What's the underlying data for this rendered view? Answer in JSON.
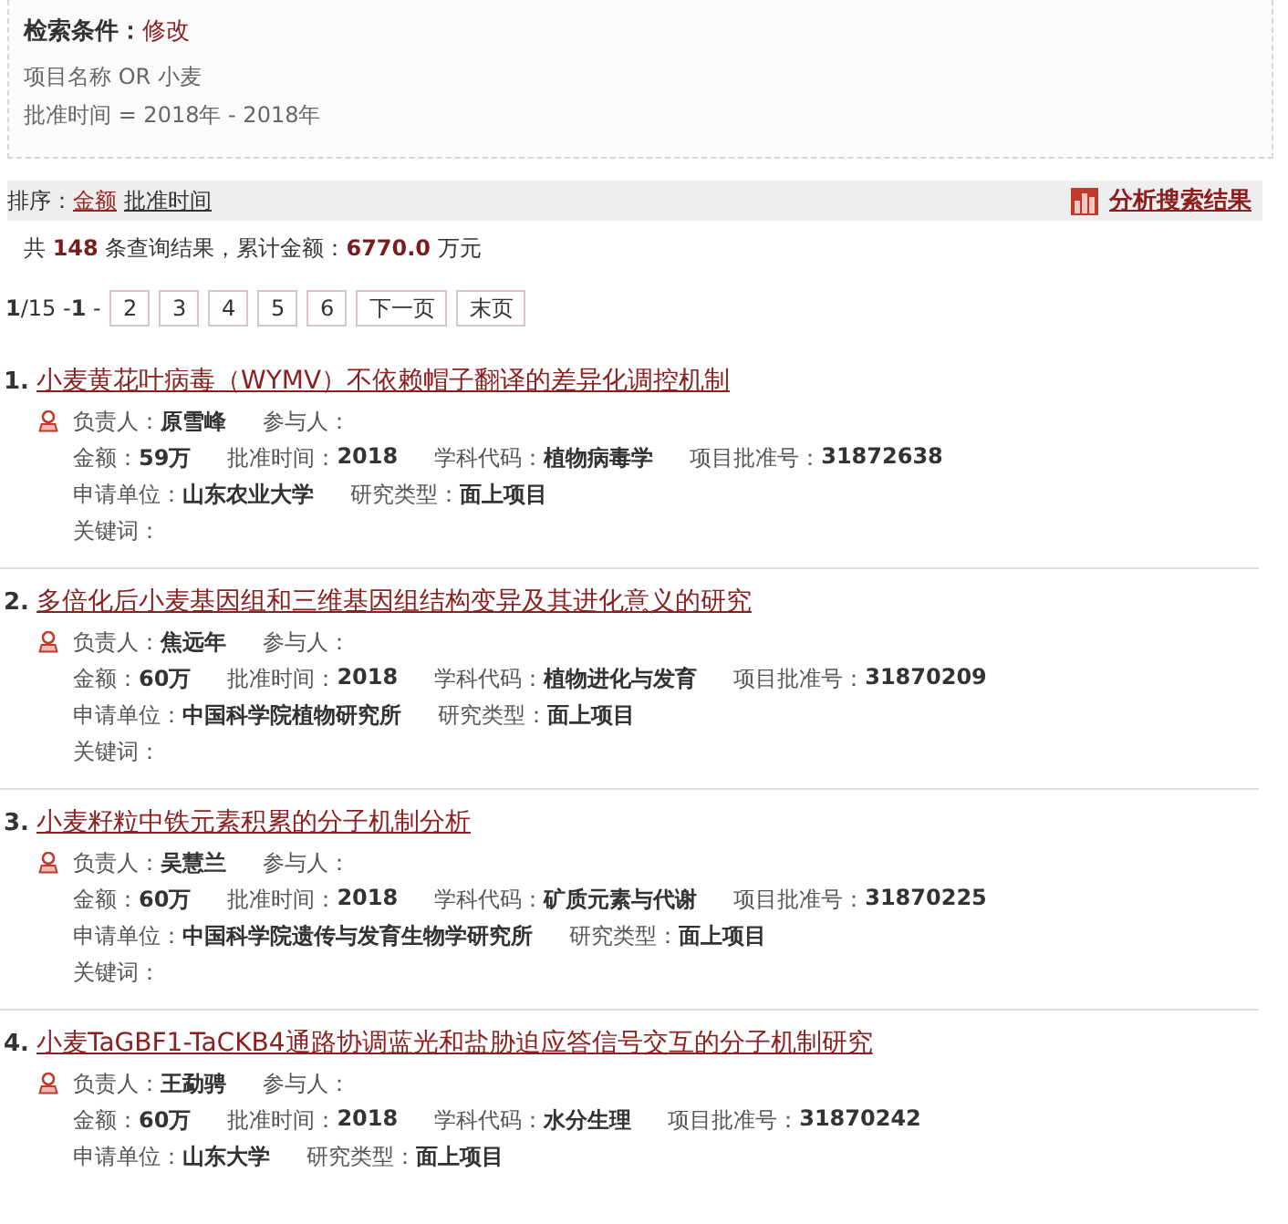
{
  "criteria": {
    "label": "检索条件：",
    "edit_link": "修改",
    "lines": [
      "项目名称 OR 小麦",
      "批准时间 = 2018年 - 2018年"
    ]
  },
  "sort": {
    "label": "排序：",
    "options": [
      {
        "label": "金额",
        "selected": true
      },
      {
        "label": "批准时间",
        "selected": false
      }
    ],
    "analyze_link": "分析搜索结果"
  },
  "summary": "共 **148** 条查询结果，累计金额：**6770.0** 万元",
  "pagination": {
    "status": "**1**/15 -**1** -",
    "pages": [
      "2",
      "3",
      "4",
      "5",
      "6",
      "下一页",
      "末页"
    ]
  },
  "results": [
    {
      "number": "1.",
      "title": "小麦黄花叶病毒（WYMV）不依赖帽子翻译的差异化调控机制",
      "leader": {
        "label": "负责人：",
        "value": "原雪峰"
      },
      "participants": {
        "label": "参与人："
      },
      "amount": {
        "label": "金额：",
        "value": "59万"
      },
      "approval_time": {
        "label": "批准时间：",
        "value": "2018"
      },
      "discipline_code": {
        "label": "学科代码：",
        "value": "植物病毒学"
      },
      "approval_number": {
        "label": "项目批准号：",
        "value": "31872638"
      },
      "applicant_unit": {
        "label": "申请单位：",
        "value": "山东农业大学"
      },
      "research_type": {
        "label": "研究类型：",
        "value": "面上项目"
      },
      "keywords": {
        "label": "关键词："
      }
    },
    {
      "number": "2.",
      "title": "多倍化后小麦基因组和三维基因组结构变异及其进化意义的研究",
      "leader": {
        "label": "负责人：",
        "value": "焦远年"
      },
      "participants": {
        "label": "参与人："
      },
      "amount": {
        "label": "金额：",
        "value": "60万"
      },
      "approval_time": {
        "label": "批准时间：",
        "value": "2018"
      },
      "discipline_code": {
        "label": "学科代码：",
        "value": "植物进化与发育"
      },
      "approval_number": {
        "label": "项目批准号：",
        "value": "31870209"
      },
      "applicant_unit": {
        "label": "申请单位：",
        "value": "中国科学院植物研究所"
      },
      "research_type": {
        "label": "研究类型：",
        "value": "面上项目"
      },
      "keywords": {
        "label": "关键词："
      }
    },
    {
      "number": "3.",
      "title": "小麦籽粒中铁元素积累的分子机制分析",
      "leader": {
        "label": "负责人：",
        "value": "吴慧兰"
      },
      "participants": {
        "label": "参与人："
      },
      "amount": {
        "label": "金额：",
        "value": "60万"
      },
      "approval_time": {
        "label": "批准时间：",
        "value": "2018"
      },
      "discipline_code": {
        "label": "学科代码：",
        "value": "矿质元素与代谢"
      },
      "approval_number": {
        "label": "项目批准号：",
        "value": "31870225"
      },
      "applicant_unit": {
        "label": "申请单位：",
        "value": "中国科学院遗传与发育生物学研究所"
      },
      "research_type": {
        "label": "研究类型：",
        "value": "面上项目"
      },
      "keywords": {
        "label": "关键词："
      }
    },
    {
      "number": "4.",
      "title": "小麦TaGBF1-TaCKB4通路协调蓝光和盐胁迫应答信号交互的分子机制研究",
      "leader": {
        "label": "负责人：",
        "value": "王勐骋"
      },
      "participants": {
        "label": "参与人："
      },
      "amount": {
        "label": "金额：",
        "value": "60万"
      },
      "approval_time": {
        "label": "批准时间：",
        "value": "2018"
      },
      "discipline_code": {
        "label": "学科代码：",
        "value": "水分生理"
      },
      "approval_number": {
        "label": "项目批准号：",
        "value": "31870242"
      },
      "applicant_unit": {
        "label": "申请单位：",
        "value": "山东大学"
      },
      "research_type": {
        "label": "研究类型：",
        "value": "面上项目"
      }
    }
  ]
}
